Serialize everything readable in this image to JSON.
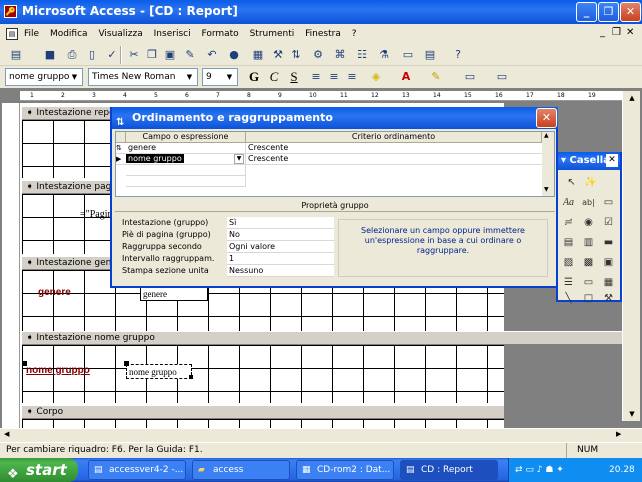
{
  "window": {
    "title": "Microsoft Access - [CD : Report]"
  },
  "menu": [
    "File",
    "Modifica",
    "Visualizza",
    "Inserisci",
    "Formato",
    "Strumenti",
    "Finestra",
    "?"
  ],
  "format_toolbar": {
    "object": "nome gruppo",
    "font": "Times New Roman",
    "size": "9"
  },
  "ruler": [
    "1",
    "2",
    "3",
    "4",
    "5",
    "6",
    "7",
    "8",
    "9",
    "10",
    "11",
    "12",
    "13",
    "14",
    "15",
    "16",
    "17",
    "18",
    "19"
  ],
  "sections": {
    "report_header": "Intestazione report",
    "page_header": "Intestazione pagina",
    "genere_header": "Intestazione genere",
    "group_header": "Intestazione nome gruppo",
    "body": "Corpo"
  },
  "controls": {
    "page_text": "=\"Pagin",
    "genere_label": "genere",
    "genere_field": "genere",
    "group_label": "nome gruppo",
    "group_field": "nome gruppo"
  },
  "dialog": {
    "title": "Ordinamento e raggruppamento",
    "col_field": "Campo o espressione",
    "col_order": "Criterio ordinamento",
    "rows": [
      {
        "field": "genere",
        "order": "Crescente"
      },
      {
        "field": "nome gruppo",
        "order": "Crescente"
      }
    ],
    "props_title": "Proprietà gruppo",
    "props": [
      {
        "k": "Intestazione (gruppo)",
        "v": "Sì"
      },
      {
        "k": "Piè di pagina (gruppo)",
        "v": "No"
      },
      {
        "k": "Raggruppa secondo",
        "v": "Ogni valore"
      },
      {
        "k": "Intervallo raggruppam.",
        "v": "1"
      },
      {
        "k": "Stampa sezione unita",
        "v": "Nessuno"
      }
    ],
    "help": "Selezionare un campo oppure immettere un'espressione in base a cui ordinare o raggruppare."
  },
  "toolbox": {
    "title": "Casella"
  },
  "status": {
    "text": "Per cambiare riquadro: F6. Per la Guida: F1.",
    "num": "NUM"
  },
  "taskbar": {
    "start": "start",
    "tasks": [
      "accessver4-2 -...",
      "access",
      "CD-rom2 : Dat...",
      "CD : Report"
    ],
    "clock": "20.28"
  }
}
